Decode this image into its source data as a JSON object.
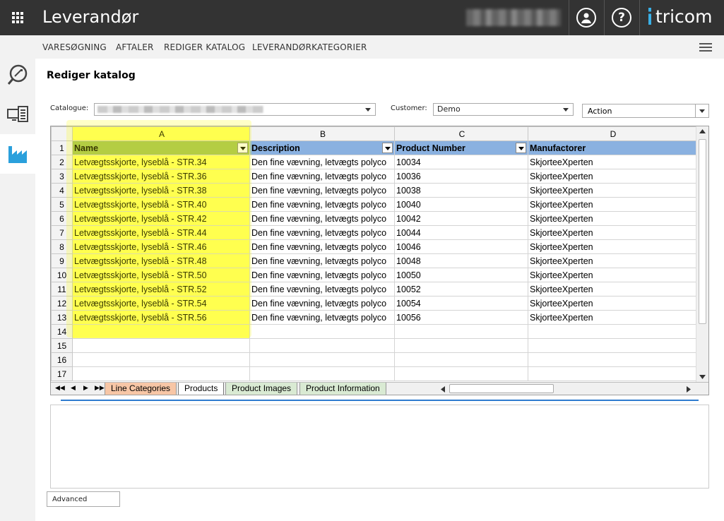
{
  "header": {
    "app_title": "Leverandør",
    "logo_text": "tricom",
    "icons": [
      "apps-grid-icon",
      "user-icon",
      "help-icon"
    ],
    "help_glyph": "?"
  },
  "nav": {
    "items": [
      "VARESØGNING",
      "AFTALER",
      "REDIGER KATALOG",
      "LEVERANDØRKATEGORIER"
    ]
  },
  "sidebar": {
    "items": [
      "search-icon",
      "catalog-icon",
      "factory-icon"
    ],
    "active": "factory-icon"
  },
  "page": {
    "title": "Rediger katalog",
    "catalogue_label": "Catalogue:",
    "customer_label": "Customer:",
    "customer_value": "Demo",
    "action_value": "Action",
    "advanced_label": "Advanced"
  },
  "sheet": {
    "column_letters": [
      "A",
      "B",
      "C",
      "D"
    ],
    "headers": [
      "Name",
      "Description",
      "Product Number",
      "Manufactorer"
    ],
    "row_numbers": [
      "1",
      "2",
      "3",
      "4",
      "5",
      "6",
      "7",
      "8",
      "9",
      "10",
      "11",
      "12",
      "13",
      "14",
      "15",
      "16",
      "17"
    ],
    "rows": [
      [
        "Letvægtsskjorte, lyseblå - STR.34",
        "Den fine vævning, letvægts polyco",
        "10034",
        "SkjorteeXperten"
      ],
      [
        "Letvægtsskjorte, lyseblå - STR.36",
        "Den fine vævning, letvægts polyco",
        "10036",
        "SkjorteeXperten"
      ],
      [
        "Letvægtsskjorte, lyseblå - STR.38",
        "Den fine vævning, letvægts polyco",
        "10038",
        "SkjorteeXperten"
      ],
      [
        "Letvægtsskjorte, lyseblå - STR.40",
        "Den fine vævning, letvægts polyco",
        "10040",
        "SkjorteeXperten"
      ],
      [
        "Letvægtsskjorte, lyseblå - STR.42",
        "Den fine vævning, letvægts polyco",
        "10042",
        "SkjorteeXperten"
      ],
      [
        "Letvægtsskjorte, lyseblå - STR.44",
        "Den fine vævning, letvægts polyco",
        "10044",
        "SkjorteeXperten"
      ],
      [
        "Letvægtsskjorte, lyseblå - STR.46",
        "Den fine vævning, letvægts polyco",
        "10046",
        "SkjorteeXperten"
      ],
      [
        "Letvægtsskjorte, lyseblå - STR.48",
        "Den fine vævning, letvægts polyco",
        "10048",
        "SkjorteeXperten"
      ],
      [
        "Letvægtsskjorte, lyseblå - STR.50",
        "Den fine vævning, letvægts polyco",
        "10050",
        "SkjorteeXperten"
      ],
      [
        "Letvægtsskjorte, lyseblå - STR.52",
        "Den fine vævning, letvægts polyco",
        "10052",
        "SkjorteeXperten"
      ],
      [
        "Letvægtsskjorte, lyseblå - STR.54",
        "Den fine vævning, letvægts polyco",
        "10054",
        "SkjorteeXperten"
      ],
      [
        "Letvægtsskjorte, lyseblå - STR.56",
        "Den fine vævning, letvægts polyco",
        "10056",
        "SkjorteeXperten"
      ],
      [
        "",
        "",
        "",
        ""
      ],
      [
        "",
        "",
        "",
        ""
      ],
      [
        "",
        "",
        "",
        ""
      ],
      [
        "",
        "",
        "",
        ""
      ]
    ],
    "tabs": [
      "Line Categories",
      "Products",
      "Product Images",
      "Product Information"
    ],
    "active_tab": "Products"
  },
  "colors": {
    "topbar": "#333333",
    "accent": "#3ab0e6",
    "highlight": "#ffff66",
    "header_blue": "#8ab1e0",
    "header_green": "#9fbf57"
  }
}
